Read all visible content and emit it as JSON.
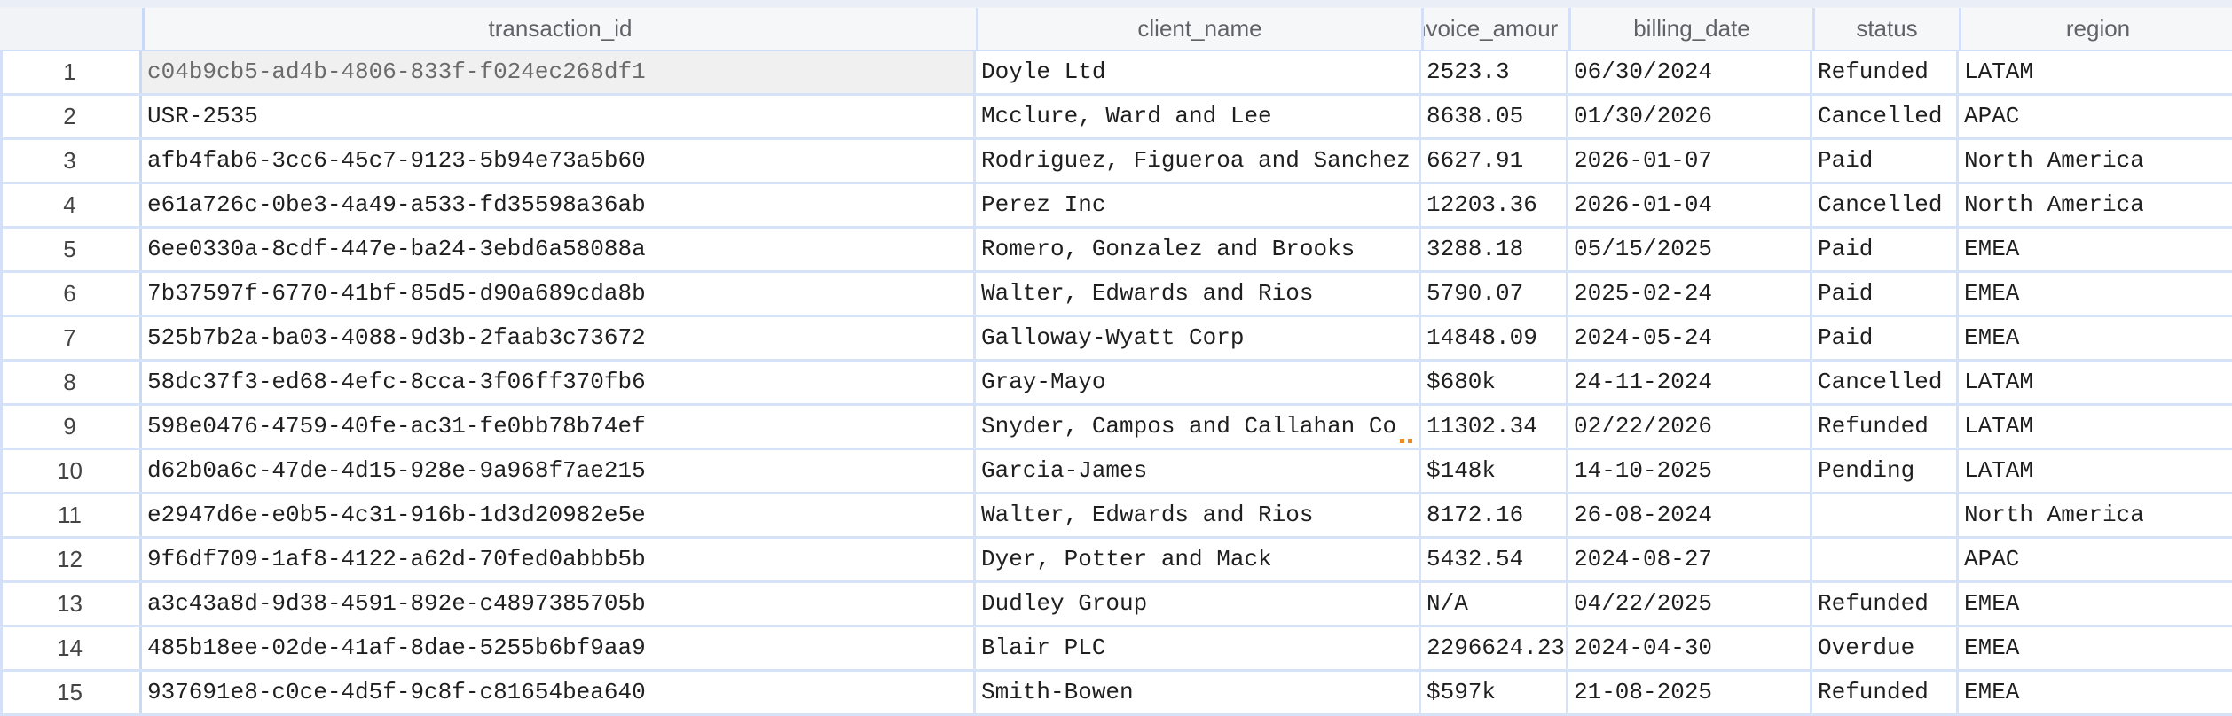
{
  "columns": [
    {
      "key": "transaction_id",
      "label": "transaction_id"
    },
    {
      "key": "client_name",
      "label": "client_name"
    },
    {
      "key": "invoice_amount",
      "label": "nvoice_amour"
    },
    {
      "key": "billing_date",
      "label": "billing_date"
    },
    {
      "key": "status",
      "label": "status"
    },
    {
      "key": "region",
      "label": "region"
    }
  ],
  "selected_cell": {
    "row": 1,
    "column": "transaction_id"
  },
  "colors": {
    "grid_line": "#d6e2f7",
    "header_bg": "#f6f7f9",
    "selected_bg": "#f0f0f0",
    "marker": "#f08a24"
  },
  "rows": [
    {
      "n": "1",
      "transaction_id": "c04b9cb5-ad4b-4806-833f-f024ec268df1",
      "client_name": "Doyle Ltd",
      "invoice_amount": "2523.3",
      "billing_date": "06/30/2024",
      "status": "Refunded",
      "region": "LATAM"
    },
    {
      "n": "2",
      "transaction_id": "USR-2535",
      "client_name": "Mcclure, Ward and Lee",
      "invoice_amount": "8638.05",
      "billing_date": "01/30/2026",
      "status": "Cancelled",
      "region": "APAC"
    },
    {
      "n": "3",
      "transaction_id": "afb4fab6-3cc6-45c7-9123-5b94e73a5b60",
      "client_name": "Rodriguez, Figueroa and Sanchez",
      "invoice_amount": "6627.91",
      "billing_date": "2026-01-07",
      "status": "Paid",
      "region": "North America"
    },
    {
      "n": "4",
      "transaction_id": "e61a726c-0be3-4a49-a533-fd35598a36ab",
      "client_name": "Perez Inc",
      "invoice_amount": "12203.36",
      "billing_date": "2026-01-04",
      "status": "Cancelled",
      "region": "North America"
    },
    {
      "n": "5",
      "transaction_id": "6ee0330a-8cdf-447e-ba24-3ebd6a58088a",
      "client_name": "Romero, Gonzalez and Brooks",
      "invoice_amount": "3288.18",
      "billing_date": "05/15/2025",
      "status": "Paid",
      "region": "EMEA"
    },
    {
      "n": "6",
      "transaction_id": "7b37597f-6770-41bf-85d5-d90a689cda8b",
      "client_name": "Walter, Edwards and Rios",
      "invoice_amount": "5790.07",
      "billing_date": "2025-02-24",
      "status": "Paid",
      "region": "EMEA"
    },
    {
      "n": "7",
      "transaction_id": "525b7b2a-ba03-4088-9d3b-2faab3c73672",
      "client_name": "Galloway-Wyatt Corp",
      "invoice_amount": "14848.09",
      "billing_date": "2024-05-24",
      "status": "Paid",
      "region": "EMEA"
    },
    {
      "n": "8",
      "transaction_id": "58dc37f3-ed68-4efc-8cca-3f06ff370fb6",
      "client_name": "Gray-Mayo",
      "invoice_amount": "$680k",
      "billing_date": "24-11-2024",
      "status": "Cancelled",
      "region": "LATAM"
    },
    {
      "n": "9",
      "transaction_id": "598e0476-4759-40fe-ac31-fe0bb78b74ef",
      "client_name": "Snyder, Campos and Callahan Co",
      "invoice_amount": "11302.34",
      "billing_date": "02/22/2026",
      "status": "Refunded",
      "region": "LATAM"
    },
    {
      "n": "10",
      "transaction_id": "d62b0a6c-47de-4d15-928e-9a968f7ae215",
      "client_name": "Garcia-James",
      "invoice_amount": "$148k",
      "billing_date": "14-10-2025",
      "status": "Pending",
      "region": "LATAM"
    },
    {
      "n": "11",
      "transaction_id": "e2947d6e-e0b5-4c31-916b-1d3d20982e5e",
      "client_name": "Walter, Edwards and Rios",
      "invoice_amount": "8172.16",
      "billing_date": "26-08-2024",
      "status": "",
      "region": "North America"
    },
    {
      "n": "12",
      "transaction_id": "9f6df709-1af8-4122-a62d-70fed0abbb5b",
      "client_name": "Dyer, Potter and Mack",
      "invoice_amount": "5432.54",
      "billing_date": "2024-08-27",
      "status": "",
      "region": "APAC"
    },
    {
      "n": "13",
      "transaction_id": "a3c43a8d-9d38-4591-892e-c4897385705b",
      "client_name": "Dudley Group",
      "invoice_amount": "N/A",
      "billing_date": "04/22/2025",
      "status": "Refunded",
      "region": "EMEA"
    },
    {
      "n": "14",
      "transaction_id": "485b18ee-02de-41af-8dae-5255b6bf9aa9",
      "client_name": "Blair PLC",
      "invoice_amount": "2296624.23",
      "billing_date": "2024-04-30",
      "status": "Overdue",
      "region": "EMEA"
    },
    {
      "n": "15",
      "transaction_id": "937691e8-c0ce-4d5f-9c8f-c81654bea640",
      "client_name": "Smith-Bowen",
      "invoice_amount": "$597k",
      "billing_date": "21-08-2025",
      "status": "Refunded",
      "region": "EMEA"
    }
  ]
}
